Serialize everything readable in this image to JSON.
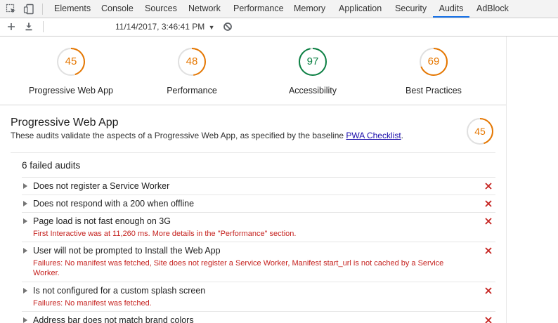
{
  "tabs": [
    {
      "label": "Elements",
      "active": false
    },
    {
      "label": "Console",
      "active": false
    },
    {
      "label": "Sources",
      "active": false
    },
    {
      "label": "Network",
      "active": false
    },
    {
      "label": "Performance",
      "active": false
    },
    {
      "label": "Memory",
      "active": false
    },
    {
      "label": "Application",
      "active": false
    },
    {
      "label": "Security",
      "active": false
    },
    {
      "label": "Audits",
      "active": true
    },
    {
      "label": "AdBlock",
      "active": false
    }
  ],
  "toolbar": {
    "report_date": "11/14/2017, 3:46:41 PM",
    "icons": [
      "plus-icon",
      "download-icon",
      "block-icon"
    ]
  },
  "summary": {
    "gauges": [
      {
        "score": 45,
        "label": "Progressive Web App",
        "status": "average"
      },
      {
        "score": 48,
        "label": "Performance",
        "status": "average"
      },
      {
        "score": 97,
        "label": "Accessibility",
        "status": "pass"
      },
      {
        "score": 69,
        "label": "Best Practices",
        "status": "average"
      }
    ]
  },
  "category": {
    "title": "Progressive Web App",
    "description": "These audits validate the aspects of a Progressive Web App, as specified by the baseline",
    "link_text": "PWA Checklist",
    "description_end": ".",
    "score": 45,
    "failed_heading": "6 failed audits"
  },
  "audits": [
    {
      "title": "Does not register a Service Worker",
      "help": ""
    },
    {
      "title": "Does not respond with a 200 when offline",
      "help": ""
    },
    {
      "title": "Page load is not fast enough on 3G",
      "help": "First Interactive was at 11,260 ms. More details in the \"Performance\" section."
    },
    {
      "title": "User will not be prompted to Install the Web App",
      "help": "Failures: No manifest was fetched, Site does not register a Service Worker, Manifest start_url is not cached by a Service Worker."
    },
    {
      "title": "Is not configured for a custom splash screen",
      "help": "Failures: No manifest was fetched."
    },
    {
      "title": "Address bar does not match brand colors",
      "help": ""
    }
  ],
  "colors": {
    "average": "#e67700",
    "pass": "#0b8043",
    "fail": "#c5221f",
    "track": "#e0e0e0",
    "active_tab": "#1a73e8"
  }
}
